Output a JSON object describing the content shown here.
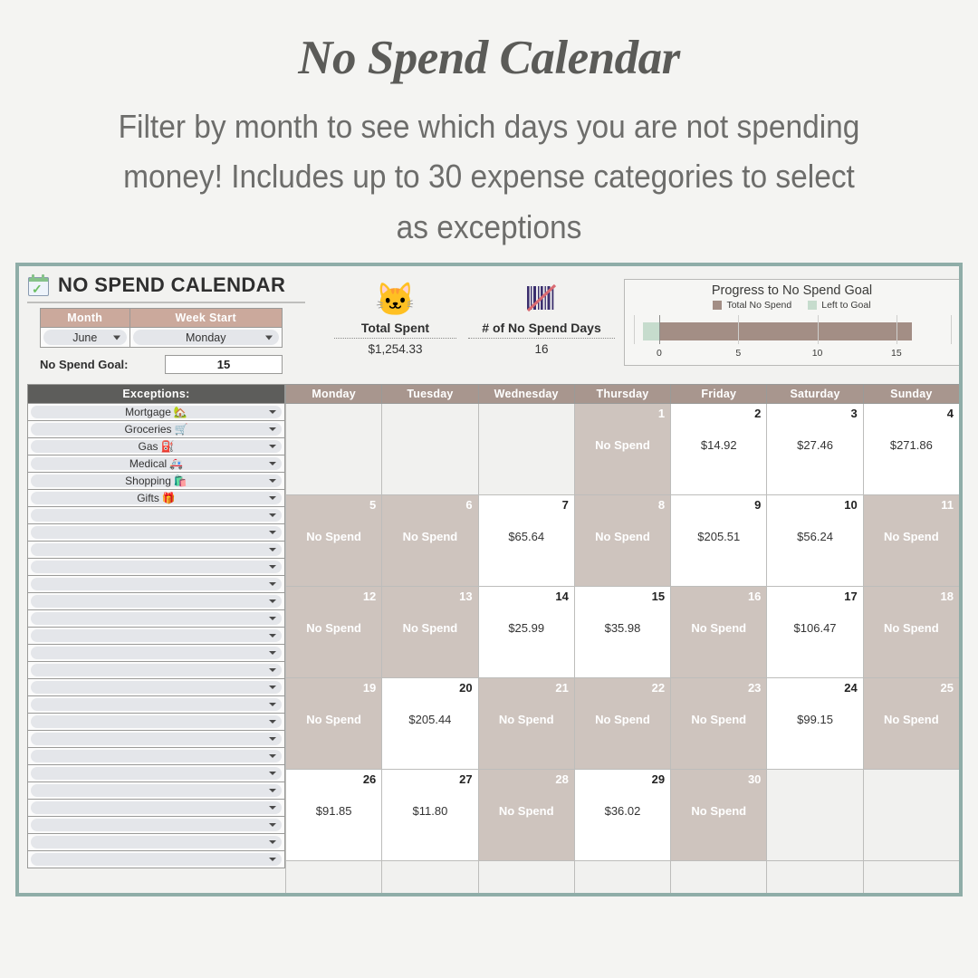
{
  "promo": {
    "title": "No Spend Calendar",
    "subtitle": "Filter by month to see which days you are not spending money! Includes up to 30 expense categories to select as exceptions"
  },
  "sheet": {
    "title": "NO SPEND CALENDAR",
    "calendar_icon": "calendar-check-icon",
    "controls": {
      "month_header": "Month",
      "week_start_header": "Week Start",
      "month_value": "June",
      "week_start_value": "Monday",
      "goal_label": "No Spend Goal:",
      "goal_value": "15"
    },
    "stats": [
      {
        "icon": "cat-face-icon",
        "label": "Total Spent",
        "value": "$1,254.33"
      },
      {
        "icon": "barcode-no-scan-icon",
        "label": "# of No Spend Days",
        "value": "16"
      }
    ],
    "exceptions": {
      "header": "Exceptions:",
      "items": [
        {
          "label": "Mortgage",
          "emoji": "🏡"
        },
        {
          "label": "Groceries",
          "emoji": "🛒"
        },
        {
          "label": "Gas",
          "emoji": "⛽"
        },
        {
          "label": "Medical",
          "emoji": "🚑"
        },
        {
          "label": "Shopping",
          "emoji": "🛍️"
        },
        {
          "label": "Gifts",
          "emoji": "🎁"
        },
        {
          "label": "",
          "emoji": ""
        },
        {
          "label": "",
          "emoji": ""
        },
        {
          "label": "",
          "emoji": ""
        },
        {
          "label": "",
          "emoji": ""
        },
        {
          "label": "",
          "emoji": ""
        },
        {
          "label": "",
          "emoji": ""
        },
        {
          "label": "",
          "emoji": ""
        },
        {
          "label": "",
          "emoji": ""
        },
        {
          "label": "",
          "emoji": ""
        },
        {
          "label": "",
          "emoji": ""
        },
        {
          "label": "",
          "emoji": ""
        },
        {
          "label": "",
          "emoji": ""
        },
        {
          "label": "",
          "emoji": ""
        },
        {
          "label": "",
          "emoji": ""
        },
        {
          "label": "",
          "emoji": ""
        },
        {
          "label": "",
          "emoji": ""
        },
        {
          "label": "",
          "emoji": ""
        },
        {
          "label": "",
          "emoji": ""
        },
        {
          "label": "",
          "emoji": ""
        },
        {
          "label": "",
          "emoji": ""
        },
        {
          "label": "",
          "emoji": ""
        }
      ]
    },
    "calendar": {
      "day_headers": [
        "Monday",
        "Tuesday",
        "Wednesday",
        "Thursday",
        "Friday",
        "Saturday",
        "Sunday"
      ],
      "no_spend_text": "No Spend",
      "weeks": [
        [
          {
            "day": "",
            "state": "blank",
            "amount": ""
          },
          {
            "day": "",
            "state": "blank",
            "amount": ""
          },
          {
            "day": "",
            "state": "blank",
            "amount": ""
          },
          {
            "day": "1",
            "state": "nospend",
            "amount": "No Spend"
          },
          {
            "day": "2",
            "state": "spend",
            "amount": "$14.92"
          },
          {
            "day": "3",
            "state": "spend",
            "amount": "$27.46"
          },
          {
            "day": "4",
            "state": "spend",
            "amount": "$271.86"
          }
        ],
        [
          {
            "day": "5",
            "state": "nospend",
            "amount": "No Spend"
          },
          {
            "day": "6",
            "state": "nospend",
            "amount": "No Spend"
          },
          {
            "day": "7",
            "state": "spend",
            "amount": "$65.64"
          },
          {
            "day": "8",
            "state": "nospend",
            "amount": "No Spend"
          },
          {
            "day": "9",
            "state": "spend",
            "amount": "$205.51"
          },
          {
            "day": "10",
            "state": "spend",
            "amount": "$56.24"
          },
          {
            "day": "11",
            "state": "nospend",
            "amount": "No Spend"
          }
        ],
        [
          {
            "day": "12",
            "state": "nospend",
            "amount": "No Spend"
          },
          {
            "day": "13",
            "state": "nospend",
            "amount": "No Spend"
          },
          {
            "day": "14",
            "state": "spend",
            "amount": "$25.99"
          },
          {
            "day": "15",
            "state": "spend",
            "amount": "$35.98"
          },
          {
            "day": "16",
            "state": "nospend",
            "amount": "No Spend"
          },
          {
            "day": "17",
            "state": "spend",
            "amount": "$106.47"
          },
          {
            "day": "18",
            "state": "nospend",
            "amount": "No Spend"
          }
        ],
        [
          {
            "day": "19",
            "state": "nospend",
            "amount": "No Spend"
          },
          {
            "day": "20",
            "state": "spend",
            "amount": "$205.44"
          },
          {
            "day": "21",
            "state": "nospend",
            "amount": "No Spend"
          },
          {
            "day": "22",
            "state": "nospend",
            "amount": "No Spend"
          },
          {
            "day": "23",
            "state": "nospend",
            "amount": "No Spend"
          },
          {
            "day": "24",
            "state": "spend",
            "amount": "$99.15"
          },
          {
            "day": "25",
            "state": "nospend",
            "amount": "No Spend"
          }
        ],
        [
          {
            "day": "26",
            "state": "spend",
            "amount": "$91.85"
          },
          {
            "day": "27",
            "state": "spend",
            "amount": "$11.80"
          },
          {
            "day": "28",
            "state": "nospend",
            "amount": "No Spend"
          },
          {
            "day": "29",
            "state": "spend",
            "amount": "$36.02"
          },
          {
            "day": "30",
            "state": "nospend",
            "amount": "No Spend"
          },
          {
            "day": "",
            "state": "blank",
            "amount": ""
          },
          {
            "day": "",
            "state": "blank",
            "amount": ""
          }
        ],
        [
          {
            "day": "",
            "state": "blank",
            "amount": ""
          },
          {
            "day": "",
            "state": "blank",
            "amount": ""
          },
          {
            "day": "",
            "state": "blank",
            "amount": ""
          },
          {
            "day": "",
            "state": "blank",
            "amount": ""
          },
          {
            "day": "",
            "state": "blank",
            "amount": ""
          },
          {
            "day": "",
            "state": "blank",
            "amount": ""
          },
          {
            "day": "",
            "state": "blank",
            "amount": ""
          }
        ]
      ]
    }
  },
  "chart_data": {
    "type": "bar",
    "orientation": "horizontal",
    "title": "Progress to No Spend Goal",
    "stacked": true,
    "categories": [
      "Progress"
    ],
    "series": [
      {
        "name": "Total No Spend",
        "values": [
          16
        ],
        "color": "#a38e85"
      },
      {
        "name": "Left to Goal",
        "values": [
          -1
        ],
        "color": "#c6dccd"
      }
    ],
    "xlabel": "",
    "ylabel": "",
    "xlim": [
      -1.6,
      18.5
    ],
    "xticks": [
      0,
      5,
      10,
      15
    ],
    "xticklabels": [
      "0",
      "5",
      "10",
      "15"
    ],
    "grid": true,
    "legend_position": "top"
  },
  "colors": {
    "panel_border": "#8fada8",
    "accent_rose": "#cba99c",
    "day_header": "#a8968e",
    "nospend_cell": "#cec4be",
    "bar_brown": "#a38e85",
    "bar_green": "#c6dccd",
    "text_dark": "#5b5b58"
  }
}
